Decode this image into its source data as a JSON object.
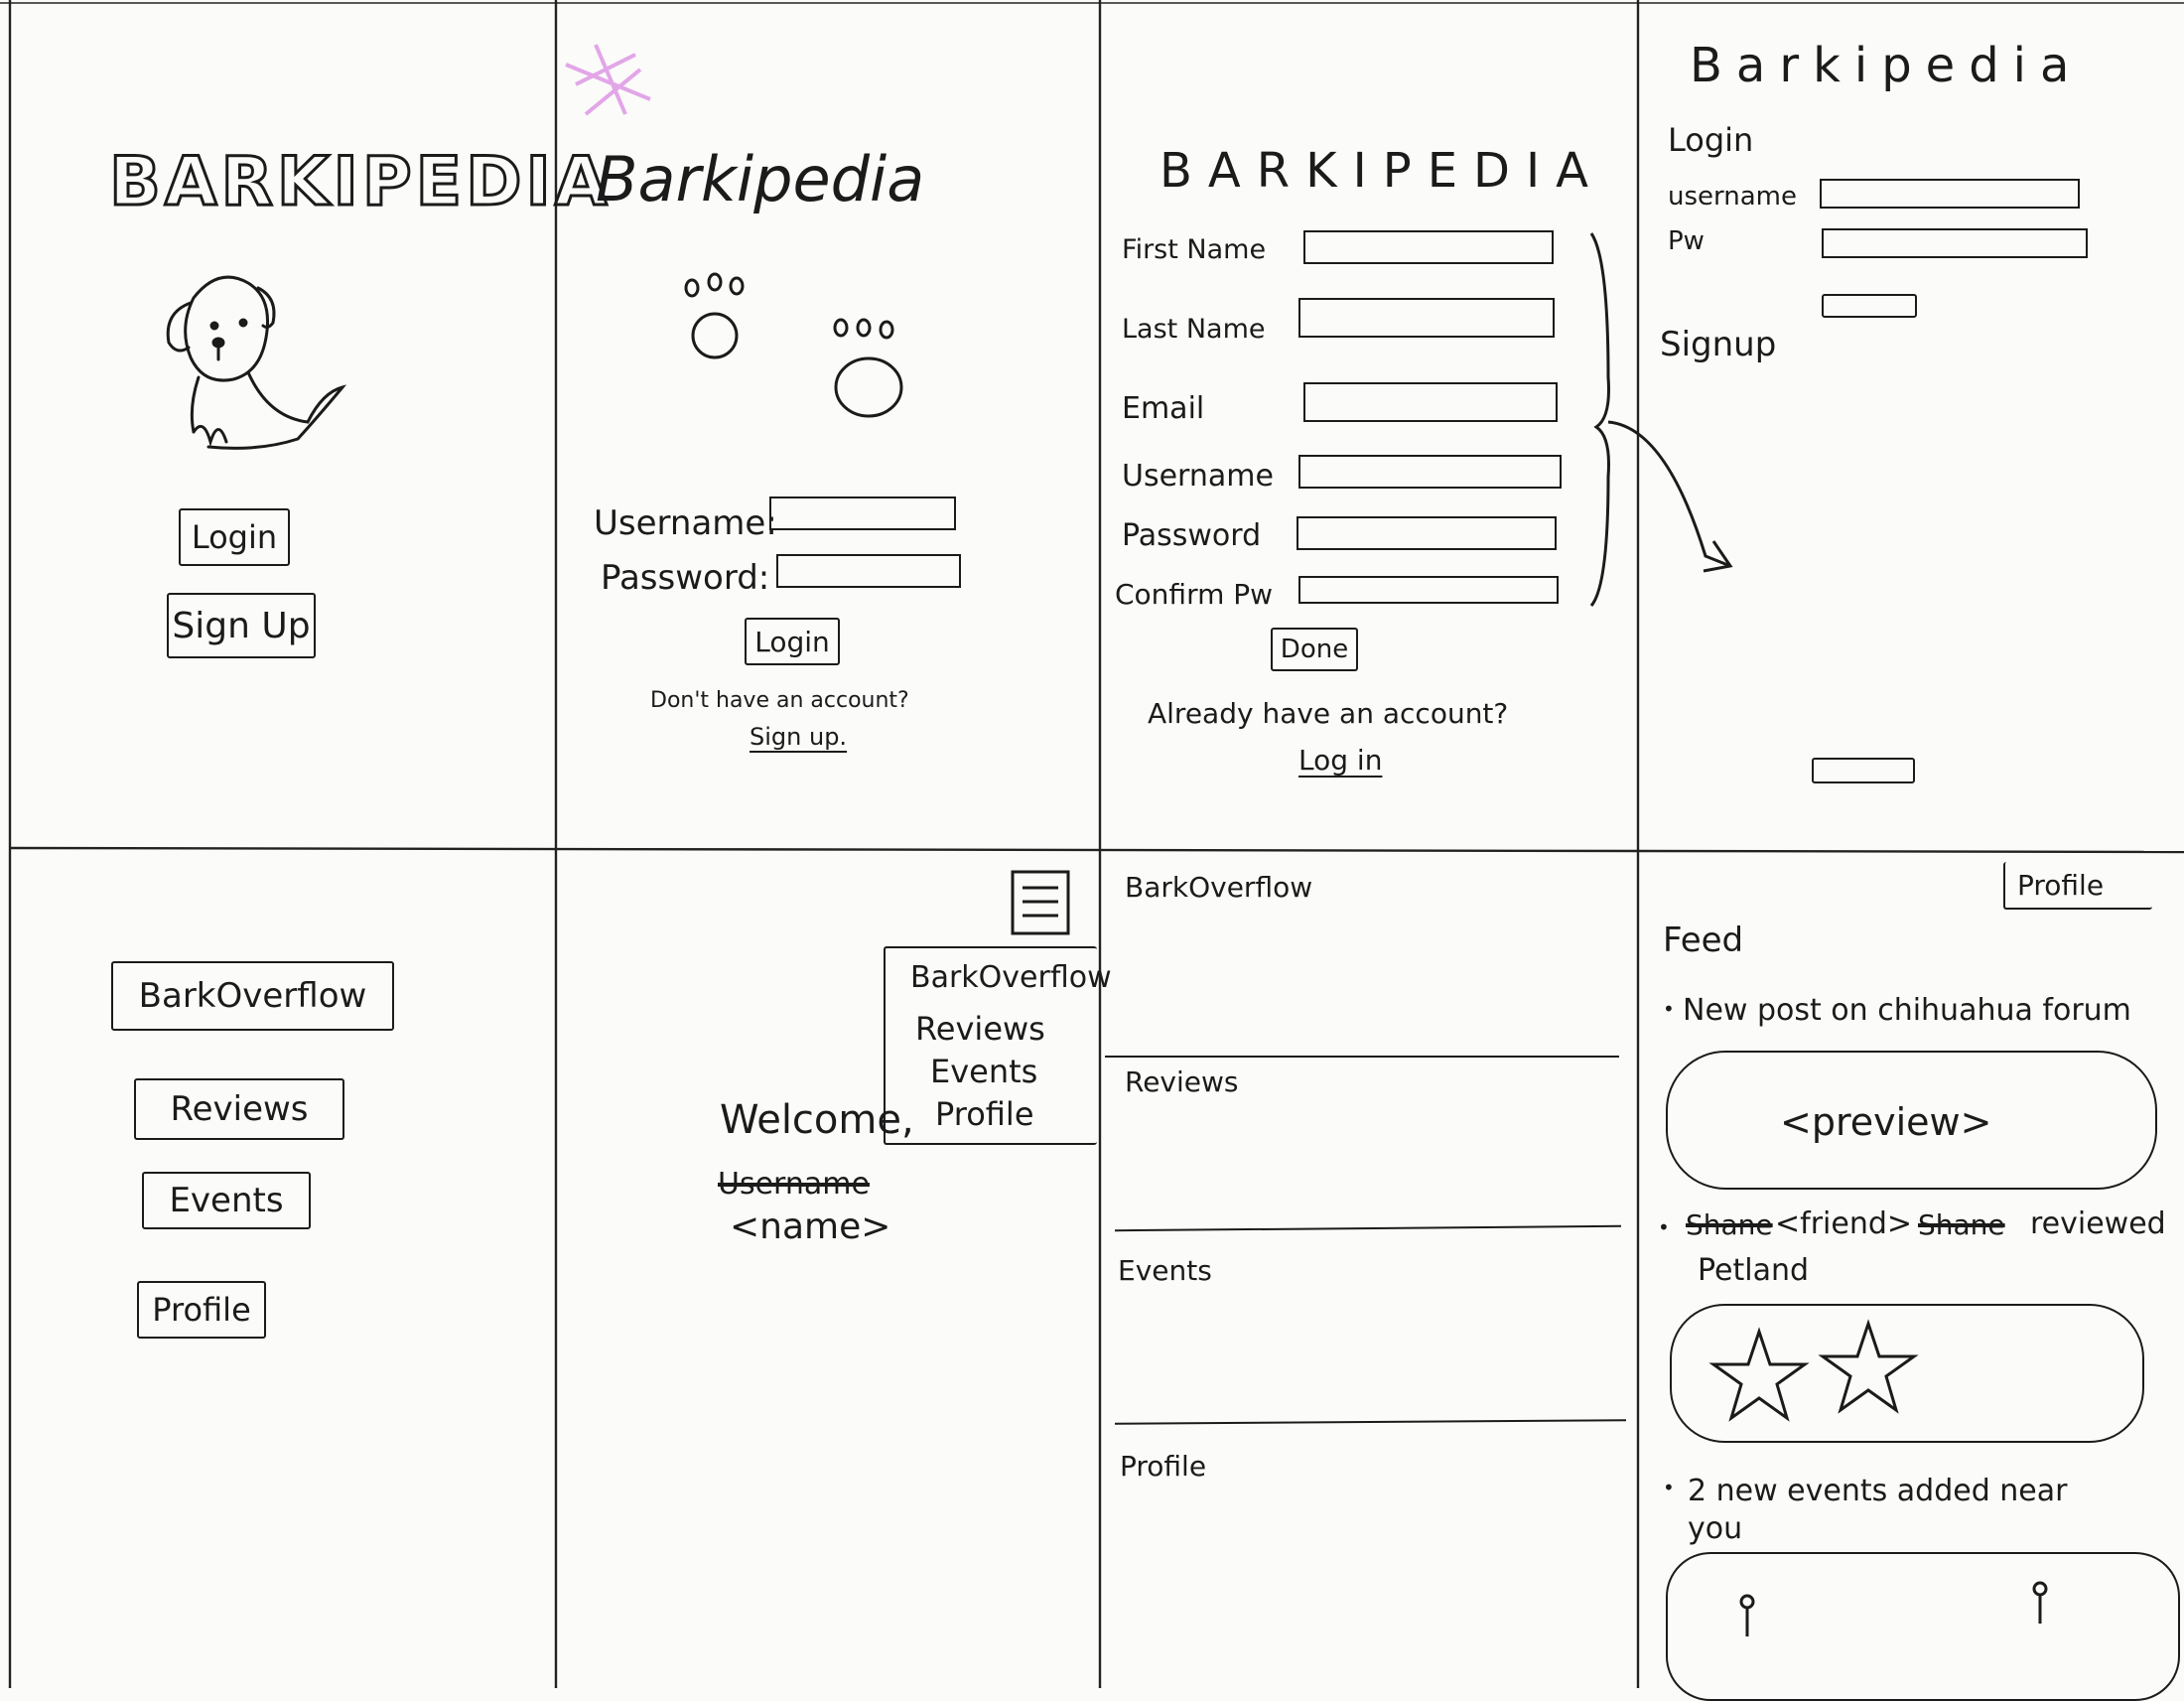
{
  "screens": {
    "s1": {
      "brand": "BARKIPEDIA",
      "login": "Login",
      "signup": "Sign Up"
    },
    "s2": {
      "brand": "Barkipedia",
      "username_label": "Username:",
      "password_label": "Password:",
      "login": "Login",
      "no_account": "Don't have an account?",
      "signup_link": "Sign up."
    },
    "s3": {
      "brand": "BARKIPEDIA",
      "fields": [
        "First Name",
        "Last Name",
        "Email",
        "Username",
        "Password",
        "Confirm Pw"
      ],
      "done": "Done",
      "have_account": "Already have an account?",
      "login_link": "Log in"
    },
    "s4": {
      "brand": "Barkipedia",
      "login": "Login",
      "username": "username",
      "pw": "Pw",
      "signup": "Signup"
    },
    "s5": {
      "items": [
        "BarkOverflow",
        "Reviews",
        "Events",
        "Profile"
      ]
    },
    "s6": {
      "menu": [
        "BarkOverflow",
        "Reviews",
        "Events",
        "Profile"
      ],
      "welcome": "Welcome,",
      "struck": "Username",
      "name": "<name>"
    },
    "s7": {
      "sections": [
        "BarkOverflow",
        "Reviews",
        "Events",
        "Profile"
      ]
    },
    "s8": {
      "profile": "Profile",
      "feed": "Feed",
      "item1": "New post on chihuahua forum",
      "preview": "<preview>",
      "item2_struck_a": "Shane",
      "item2_friend": "<friend>",
      "item2_struck_b": "Shane",
      "item2_verb": "reviewed",
      "item2_place": "Petland",
      "item3": "2 new events added near you"
    }
  }
}
